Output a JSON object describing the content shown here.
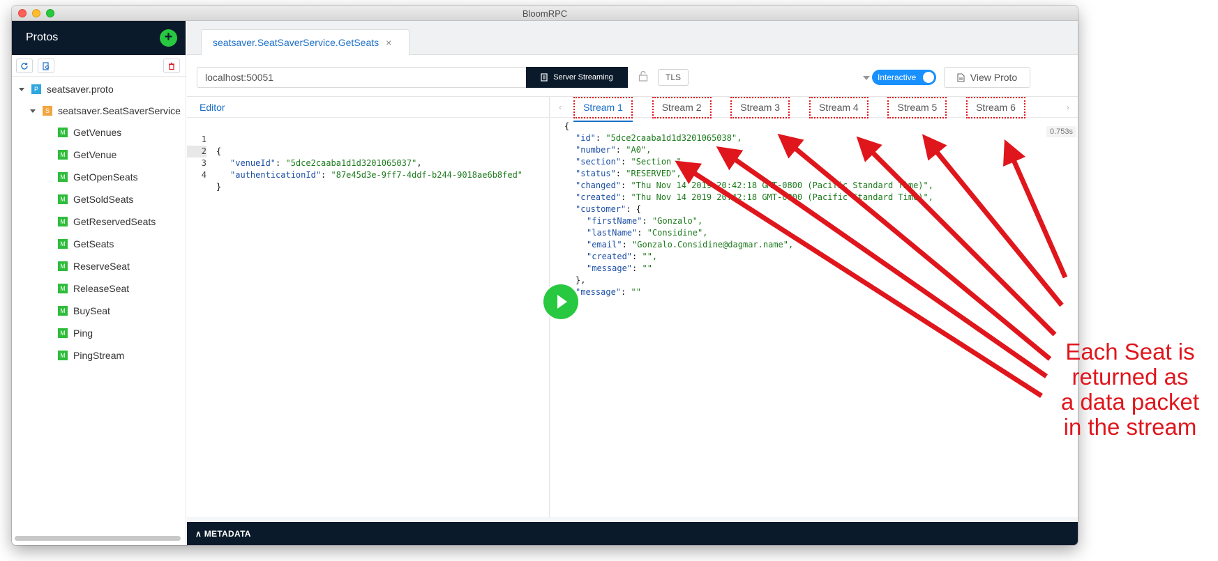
{
  "window": {
    "title": "BloomRPC"
  },
  "sidebar": {
    "title": "Protos",
    "add_icon": "plus-icon",
    "tools": [
      "refresh-icon",
      "import-path-icon",
      "trash-icon"
    ],
    "proto_file": "seatsaver.proto",
    "service": "seatsaver.SeatSaverService",
    "methods": [
      "GetVenues",
      "GetVenue",
      "GetOpenSeats",
      "GetSoldSeats",
      "GetReservedSeats",
      "GetSeats",
      "ReserveSeat",
      "ReleaseSeat",
      "BuySeat",
      "Ping",
      "PingStream"
    ],
    "badges": {
      "proto": "P",
      "service": "S",
      "method": "M"
    }
  },
  "tab": {
    "label": "seatsaver.SeatSaverService.GetSeats",
    "close": "×"
  },
  "toolbar": {
    "url": "localhost:50051",
    "mode_label": "Server Streaming",
    "tls_label": "TLS",
    "interactive_label": "Interactive",
    "view_proto_label": "View Proto"
  },
  "editor": {
    "label": "Editor",
    "lines": [
      {
        "num": "1",
        "text": "{"
      },
      {
        "num": "2",
        "key": "\"venueId\"",
        "value": "\"5dce2caaba1d1d3201065037\""
      },
      {
        "num": "3",
        "key": "\"authenticationId\"",
        "value": "\"87e45d3e-9ff7-4ddf-b244-9018ae6b8fed\""
      },
      {
        "num": "4",
        "text": "}"
      }
    ]
  },
  "response": {
    "streams": [
      "Stream 1",
      "Stream 2",
      "Stream 3",
      "Stream 4",
      "Stream 5",
      "Stream 6"
    ],
    "active_stream": "Stream 1",
    "elapsed": "0.753s",
    "lines": [
      {
        "text": "{"
      },
      {
        "key": "\"id\"",
        "value": "\"5dce2caaba1d1d3201065038\","
      },
      {
        "key": "\"number\"",
        "value": "\"A0\","
      },
      {
        "key": "\"section\"",
        "value": "\"Section \","
      },
      {
        "key": "\"status\"",
        "value": "\"RESERVED\","
      },
      {
        "key": "\"changed\"",
        "value": "\"Thu Nov 14 2019 20:42:18 GMT-0800 (Pacific Standard Time)\","
      },
      {
        "key": "\"created\"",
        "value": "\"Thu Nov 14 2019 20:42:18 GMT-0800 (Pacific Standard Time)\","
      },
      {
        "key": "\"customer\"",
        "value": "{"
      },
      {
        "key": "\"firstName\"",
        "value": "\"Gonzalo\",",
        "indent": 2
      },
      {
        "key": "\"lastName\"",
        "value": "\"Considine\",",
        "indent": 2
      },
      {
        "key": "\"email\"",
        "value": "\"Gonzalo.Considine@dagmar.name\",",
        "indent": 2
      },
      {
        "key": "\"created\"",
        "value": "\"\",",
        "indent": 2
      },
      {
        "key": "\"message\"",
        "value": "\"\"",
        "indent": 2
      },
      {
        "text": "},",
        "indent": 1
      },
      {
        "key": "\"message\"",
        "value": "\"\""
      },
      {
        "text": "}"
      }
    ]
  },
  "metadata": {
    "label": "METADATA"
  },
  "annotation": {
    "lines": [
      "Each Seat is",
      "returned as",
      "a data packet",
      "in the stream"
    ],
    "color": "#e0161d"
  }
}
